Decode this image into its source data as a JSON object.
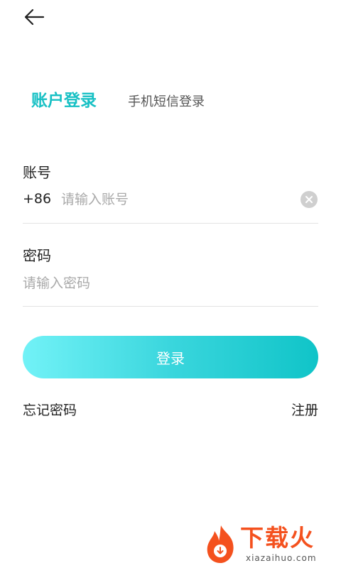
{
  "header": {
    "back_icon": "arrow-left-icon"
  },
  "tabs": {
    "account_login": "账户登录",
    "sms_login": "手机短信登录"
  },
  "colors": {
    "accent": "#17c0c4",
    "gradient_start": "#72f2f7",
    "gradient_end": "#10c4c8",
    "placeholder": "#a9a9a9",
    "watermark": "#f4511e"
  },
  "form": {
    "account": {
      "label": "账号",
      "country_code": "+86",
      "placeholder": "请输入账号",
      "value": "",
      "clear_icon": "clear-circle-icon"
    },
    "password": {
      "label": "密码",
      "placeholder": "请输入密码",
      "value": ""
    },
    "submit_label": "登录"
  },
  "links": {
    "forgot_password": "忘记密码",
    "register": "注册"
  },
  "watermark": {
    "title": "下载火",
    "subtitle": "xiazaihuo.com"
  }
}
